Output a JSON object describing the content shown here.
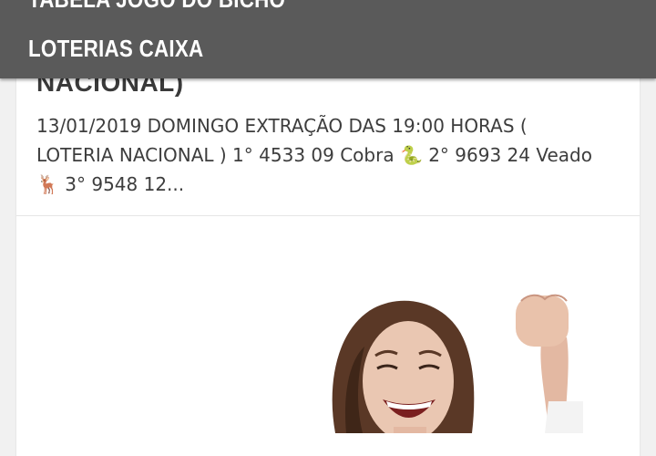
{
  "menu": {
    "items": [
      {
        "label": "TABELA JOGO DO BICHO"
      },
      {
        "label": "LOTERIAS CAIXA"
      }
    ]
  },
  "post": {
    "title_fragment": "NACIONAL)",
    "excerpt_part1": "13/01/2019 DOMINGO EXTRAÇÃO DAS 19:00 HORAS ( LOTERIA NACIONAL ) 1° 4533   09 Cobra ",
    "snake_emoji": "🐍",
    "excerpt_part2": " 2° 9693   24 Veado ",
    "deer_emoji": "🦌",
    "excerpt_part3": " 3° 9548   12..."
  },
  "colors": {
    "menu_bg": "#5a5a5a",
    "menu_text": "#ffffff",
    "page_bg": "#f1f1f1",
    "card_bg": "#ffffff",
    "text": "#3d3d3d"
  },
  "icons": {
    "snake": "snake-emoji-icon",
    "deer": "deer-emoji-icon"
  }
}
